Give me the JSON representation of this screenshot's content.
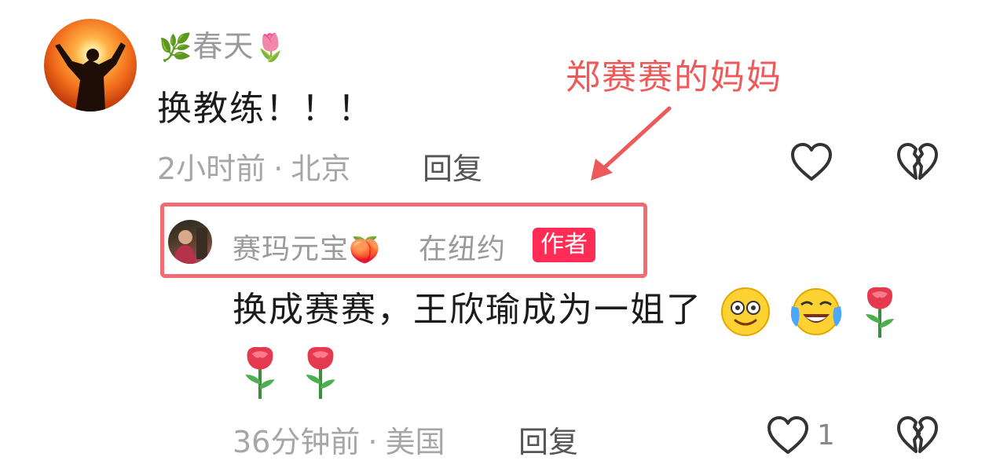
{
  "comment1": {
    "nickname": "春天",
    "nickname_prefix_icon": "herb-icon",
    "nickname_suffix_icon": "tulip-icon",
    "content": "换教练！！！",
    "time": "2小时前",
    "location": "北京",
    "separator": "·",
    "reply_label": "回复"
  },
  "annotation": {
    "text": "郑赛赛的妈妈",
    "color": "#ee5a5a"
  },
  "comment2": {
    "nickname": "赛玛元宝",
    "nickname_suffix_icon": "peach-icon",
    "location_text": "在纽约",
    "badge": "作者",
    "content": "换成赛赛，王欣瑜成为一姐了",
    "emojis": [
      "smiling-face-icon",
      "laughing-crying-face-icon",
      "rose-icon",
      "rose-icon",
      "rose-icon"
    ],
    "time": "36分钟前",
    "location": "美国",
    "separator": "·",
    "reply_label": "回复",
    "like_count": "1"
  },
  "colors": {
    "badge": "#ff2d55",
    "meta_text": "#a6a6a6",
    "highlight_box": "#f26a73"
  }
}
